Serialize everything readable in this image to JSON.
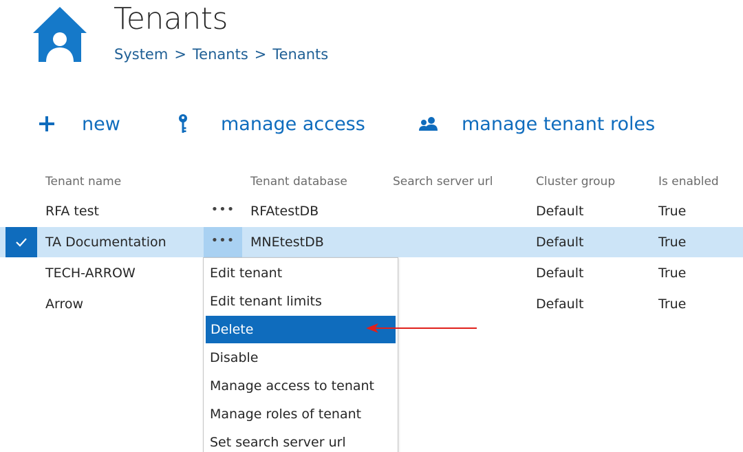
{
  "header": {
    "title": "Tenants",
    "breadcrumb": [
      "System",
      "Tenants",
      "Tenants"
    ],
    "breadcrumb_separator": ">",
    "icon": "home-user-icon"
  },
  "toolbar": {
    "new_label": "new",
    "manage_access_label": "manage access",
    "manage_tenant_roles_label": "manage tenant roles",
    "icons": [
      "plus-icon",
      "key-icon",
      "users-icon"
    ]
  },
  "table": {
    "columns": [
      "Tenant name",
      "Tenant database",
      "Search server url",
      "Cluster group",
      "Is enabled"
    ],
    "rows": [
      {
        "name": "RFA test",
        "database": "RFAtestDB",
        "search_url": "",
        "cluster": "Default",
        "enabled": "True",
        "selected": false
      },
      {
        "name": "TA Documentation",
        "database": "MNEtestDB",
        "search_url": "",
        "cluster": "Default",
        "enabled": "True",
        "selected": true
      },
      {
        "name": "TECH-ARROW",
        "database": "",
        "search_url": "",
        "cluster": "Default",
        "enabled": "True",
        "selected": false
      },
      {
        "name": "Arrow",
        "database": "",
        "search_url": "",
        "cluster": "Default",
        "enabled": "True",
        "selected": false
      }
    ],
    "row_menu_glyph": "•••"
  },
  "context_menu": {
    "items": [
      "Edit tenant",
      "Edit tenant limits",
      "Delete",
      "Disable",
      "Manage access to tenant",
      "Manage roles of tenant",
      "Set search server url"
    ],
    "highlighted_item": "Delete"
  },
  "colors": {
    "accent": "#0f6cbd",
    "breadcrumb": "#1f5f95",
    "selected_row": "#cce4f7",
    "annotation_arrow": "#e0201b"
  }
}
